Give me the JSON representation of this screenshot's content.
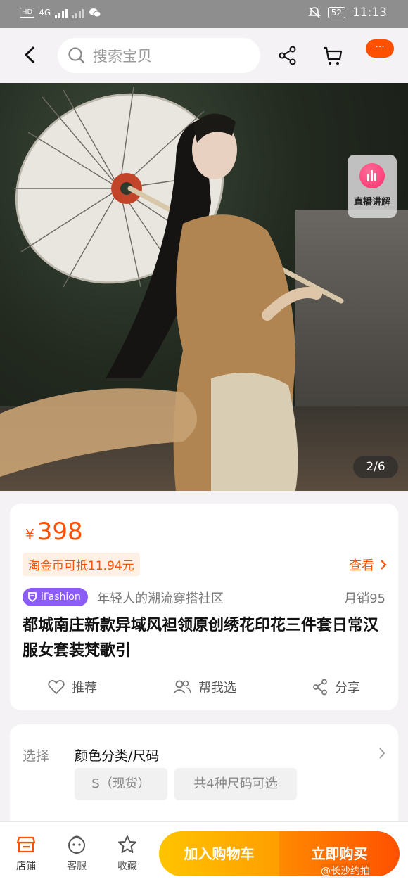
{
  "status_bar": {
    "network": "4G",
    "battery": "52",
    "time": "11:13"
  },
  "nav": {
    "search_placeholder": "搜索宝贝",
    "more_label": "···"
  },
  "gallery": {
    "live_label": "直播讲解",
    "pager": "2/6"
  },
  "product": {
    "currency": "¥",
    "price": "398",
    "coin_discount": "淘金币可抵11.94元",
    "view_label": "查看",
    "badge": "iFashion",
    "tagline": "年轻人的潮流穿搭社区",
    "monthly_sales": "月销95",
    "title": "都城南庄新款异域风袒领原创绣花印花三件套日常汉服女套装梵歌引",
    "actions": [
      "推荐",
      "帮我选",
      "分享"
    ]
  },
  "options": {
    "label": "选择",
    "value": "颜色分类/尺码",
    "chips": [
      "S（现货）",
      "共4种尺码可选"
    ]
  },
  "bottom_bar": {
    "tabs": [
      "店铺",
      "客服",
      "收藏"
    ],
    "add_to_cart": "加入购物车",
    "buy_now": "立即购买"
  },
  "watermark": "@长沙约拍",
  "colors": {
    "accent": "#ff5000",
    "cart_button": "#ffb800",
    "ifashion_badge": "#8b5cf6"
  }
}
